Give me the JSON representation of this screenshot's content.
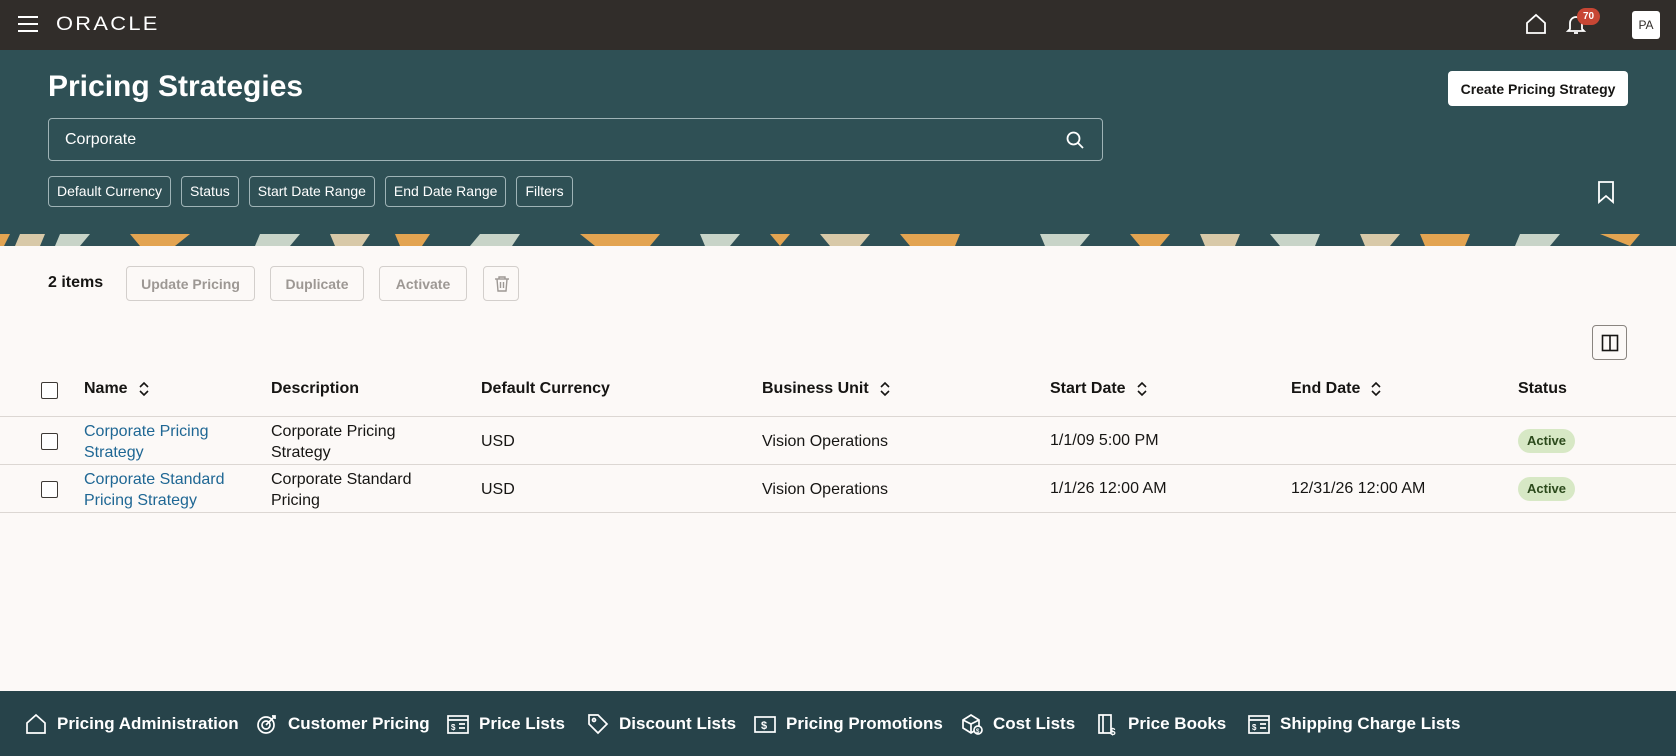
{
  "topbar": {
    "logo": "ORACLE",
    "notification_count": "70",
    "user_initials": "PA"
  },
  "header": {
    "title": "Pricing Strategies",
    "create_button": "Create Pricing Strategy",
    "search_value": "Corporate",
    "filter_chips": [
      "Default Currency",
      "Status",
      "Start Date Range",
      "End Date Range",
      "Filters"
    ]
  },
  "toolbar": {
    "item_count": "2 items",
    "update_pricing": "Update Pricing",
    "duplicate": "Duplicate",
    "activate": "Activate"
  },
  "table": {
    "columns": [
      "Name",
      "Description",
      "Default Currency",
      "Business Unit",
      "Start Date",
      "End Date",
      "Status"
    ],
    "rows": [
      {
        "name_line1": "Corporate Pricing",
        "name_line2": "Strategy",
        "desc_line1": "Corporate Pricing",
        "desc_line2": "Strategy",
        "currency": "USD",
        "business_unit": "Vision Operations",
        "start_date": "1/1/09 5:00 PM",
        "end_date": "",
        "status": "Active"
      },
      {
        "name_line1": "Corporate Standard",
        "name_line2": "Pricing Strategy",
        "desc_line1": "Corporate Standard",
        "desc_line2": "Pricing",
        "currency": "USD",
        "business_unit": "Vision Operations",
        "start_date": "1/1/26 12:00 AM",
        "end_date": "12/31/26 12:00 AM",
        "status": "Active"
      }
    ]
  },
  "bottom_nav": [
    {
      "label": "Pricing Administration",
      "icon": "home-icon"
    },
    {
      "label": "Customer Pricing",
      "icon": "target-icon"
    },
    {
      "label": "Price Lists",
      "icon": "price-list-icon"
    },
    {
      "label": "Discount Lists",
      "icon": "tag-icon"
    },
    {
      "label": "Pricing Promotions",
      "icon": "dollar-icon"
    },
    {
      "label": "Cost Lists",
      "icon": "cost-icon"
    },
    {
      "label": "Price Books",
      "icon": "price-book-icon"
    },
    {
      "label": "Shipping Charge Lists",
      "icon": "shipping-icon"
    }
  ],
  "colors": {
    "topbar": "#312d2a",
    "header": "#2f5055",
    "link": "#1f6794",
    "status_active_bg": "#d7e8c5",
    "badge": "#c74634",
    "bottom_nav": "#27434a"
  }
}
